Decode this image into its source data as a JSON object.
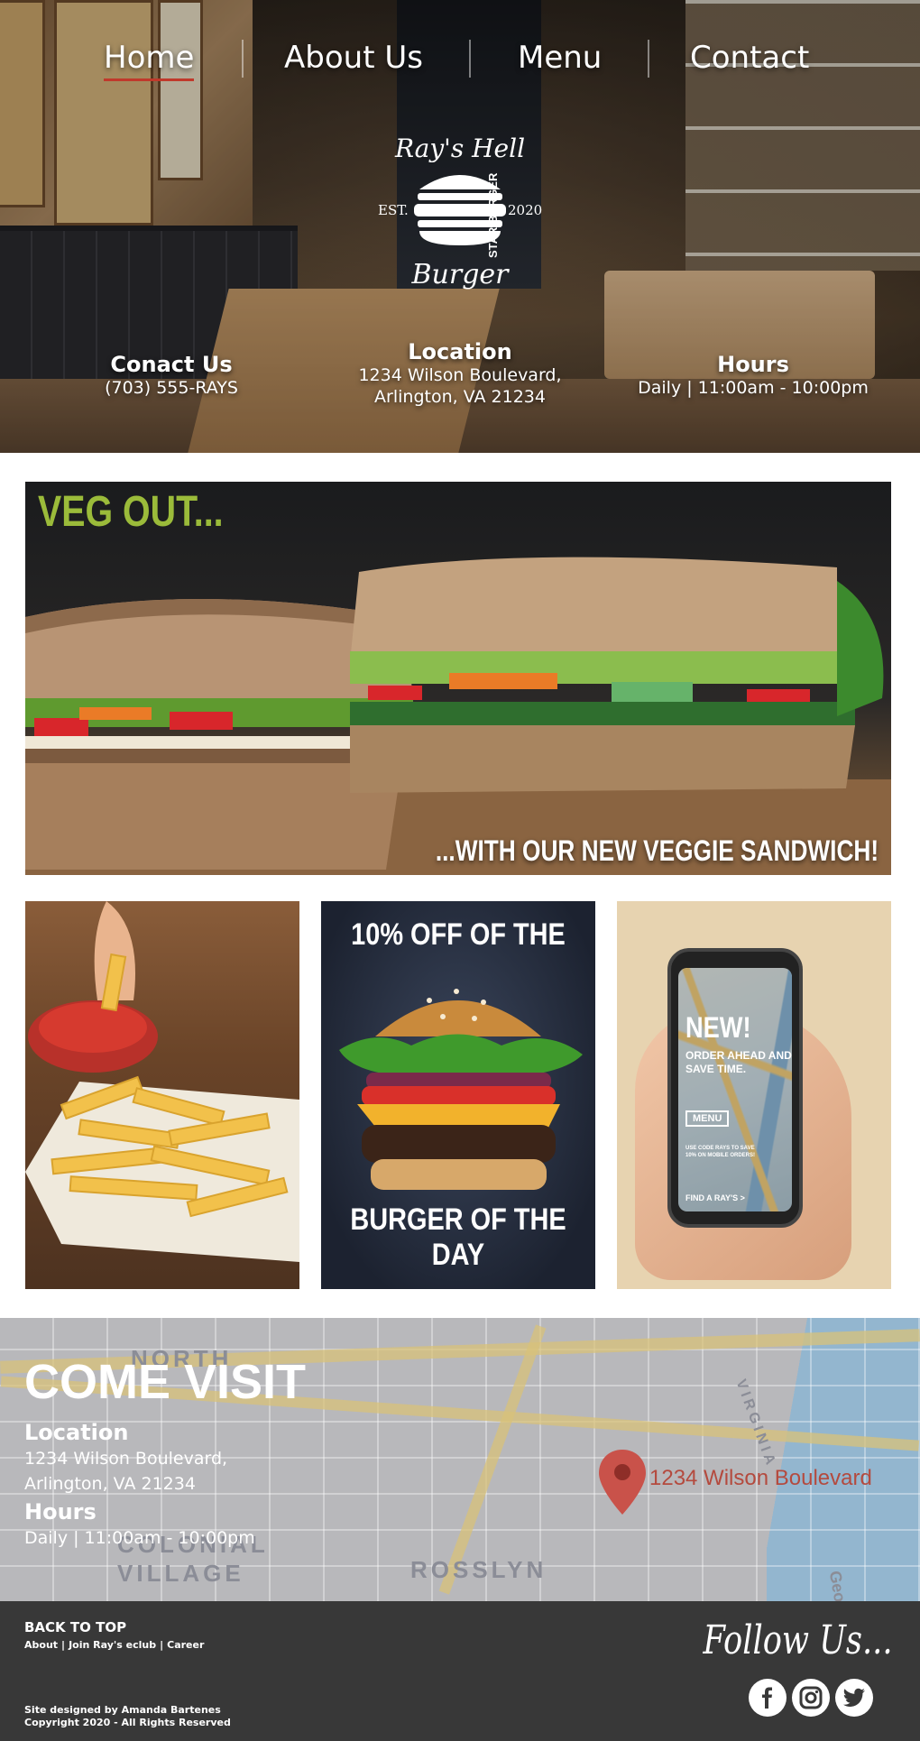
{
  "nav": {
    "items": [
      {
        "label": "Home",
        "active": true
      },
      {
        "label": "About Us",
        "active": false
      },
      {
        "label": "Menu",
        "active": false
      },
      {
        "label": "Contact",
        "active": false
      }
    ]
  },
  "logo": {
    "top_script": "Ray's Hell",
    "bottom_script": "Burger",
    "est": "EST.",
    "year": "2020",
    "side": "STAR BURGER"
  },
  "hero_info": {
    "contact": {
      "title": "Conact Us",
      "line1": "(703) 555-RAYS"
    },
    "location": {
      "title": "Location",
      "line1": "1234 Wilson Boulevard,",
      "line2": "Arlington, VA 21234"
    },
    "hours": {
      "title": "Hours",
      "line1": "Daily | 11:00am - 10:00pm"
    }
  },
  "banner": {
    "title": "VEG OUT...",
    "subtitle": "...WITH OUR NEW VEGGIE SANDWICH!"
  },
  "tiles": {
    "burger": {
      "top": "10% OFF OF THE",
      "bottom": "BURGER OF THE DAY"
    },
    "app": {
      "new": "NEW!",
      "order": "ORDER AHEAD AND SAVE TIME.",
      "menu": "MENU",
      "code": "USE CODE RAYS TO SAVE 10% ON MOBILE ORDERS!",
      "find": "FIND A RAY'S >"
    }
  },
  "visit": {
    "title": "COME VISIT",
    "location_title": "Location",
    "location_line1": "1234 Wilson Boulevard,",
    "location_line2": "Arlington, VA 21234",
    "hours_title": "Hours",
    "hours_line1": "Daily | 11:00am - 10:00pm",
    "pin_label": "1234 Wilson Boulevard",
    "map_labels": [
      "NORTH",
      "COLONIAL",
      "VILLAGE",
      "ROSSLYN",
      "VIRGINIA",
      "Geo"
    ]
  },
  "footer": {
    "back_to_top": "BACK TO TOP",
    "links": [
      "About",
      "Join Ray's eclub",
      "Career"
    ],
    "credit_line1": "Site designed by Amanda Bartenes",
    "credit_line2": "Copyright 2020 - All Rights Reserved",
    "follow": "Follow Us...",
    "social": [
      "facebook-icon",
      "instagram-icon",
      "twitter-icon"
    ]
  },
  "colors": {
    "accent_green": "#9bbb3a",
    "accent_red": "#c0392b",
    "footer_bg": "#383838",
    "pin": "#c9524a"
  }
}
